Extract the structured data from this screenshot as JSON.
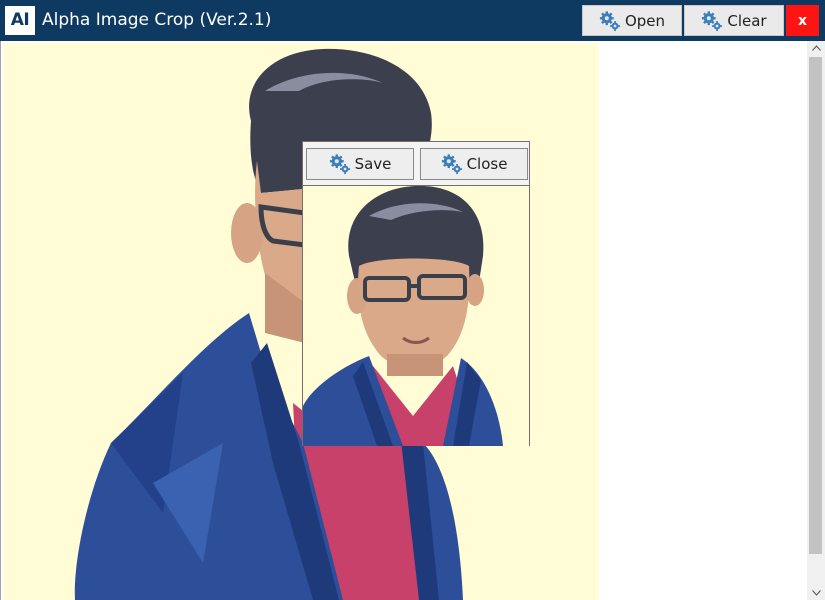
{
  "app": {
    "logo_text": "AI",
    "title": "Alpha Image Crop (Ver.2.1)"
  },
  "toolbar": {
    "open_label": "Open",
    "clear_label": "Clear",
    "close_label": "x",
    "icon": "gears-icon"
  },
  "crop_panel": {
    "save_label": "Save",
    "close_label": "Close",
    "icon": "gears-icon"
  },
  "colors": {
    "titlebar": "#0e3a62",
    "close_button": "#ff1414",
    "photo_background": "#fffcd6",
    "gear_icon": "#3e7eb8"
  }
}
